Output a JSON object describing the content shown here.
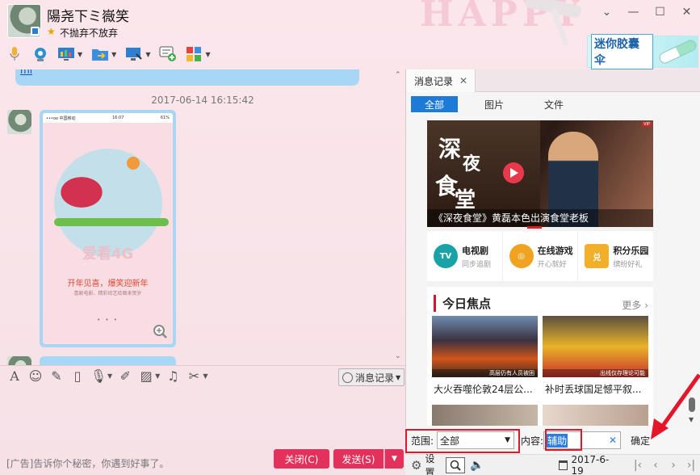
{
  "header": {
    "contact_name": "陽尧下ミ嶶笑",
    "signature": "不抛弃不放弃",
    "decor_text": "HAPPY",
    "ad_banner_text": "迷你胶囊伞"
  },
  "chat": {
    "prev_link_text": "ml",
    "timestamp": "2017-06-14 16:15:42",
    "image_message": {
      "status_carrier": "•••oo 中国移动",
      "status_time": "16:07",
      "status_battery": "61%",
      "big_text": "爱看4G",
      "red_text": "开年见喜，爆笑迎新年",
      "small_text": "喜剧电影、精彩综艺给图来贺岁",
      "page_dots": "• • •"
    }
  },
  "input_toolbar": {
    "history_label": "消息记录"
  },
  "footer": {
    "ad_text": "[广告]告诉你个秘密，你遇到好事了。",
    "close_label": "关闭(C)",
    "send_label": "发送(S)"
  },
  "right_panel": {
    "tab_label": "消息记录",
    "filters": [
      "全部",
      "图片",
      "文件"
    ],
    "ad": {
      "hero_chars": [
        "深",
        "夜",
        "食",
        "堂"
      ],
      "hero_caption": "《深夜食堂》黄磊本色出演食堂老板",
      "hero_badge": "VIP",
      "services": [
        {
          "title": "电视剧",
          "sub": "同步追剧",
          "icon": "TV",
          "color": "#19a3a8"
        },
        {
          "title": "在线游戏",
          "sub": "开心就好",
          "icon": "◎",
          "color": "#f0a321"
        },
        {
          "title": "积分乐园",
          "sub": "缤纷好礼",
          "icon": "兑",
          "color": "#f2b02a"
        }
      ],
      "focus_title": "今日焦点",
      "focus_more": "更多",
      "news": [
        {
          "title": "大火吞噬伦敦24层公...",
          "caption": "高层仍有人员被困"
        },
        {
          "title": "补时丢球国足憾平叙...",
          "caption": "出线仅存理论可能"
        }
      ]
    },
    "search": {
      "range_label": "范围:",
      "range_value": "全部",
      "content_label": "内容:",
      "content_value": "辅助",
      "ok_label": "确定"
    },
    "status": {
      "settings_label": "设置",
      "date": "2017-6-19"
    }
  },
  "colors": {
    "accent_blue": "#1e7ad7",
    "button_red": "#e2315b",
    "highlight_red": "#e3162a",
    "bubble_blue": "#a7d7f4"
  }
}
